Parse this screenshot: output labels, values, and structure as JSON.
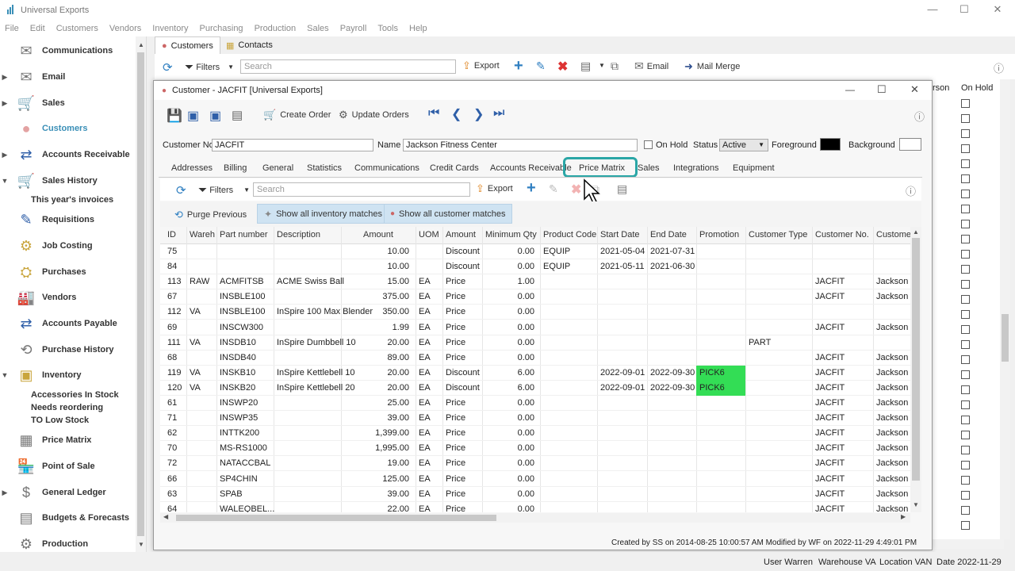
{
  "app": {
    "title": "Universal Exports"
  },
  "menu": [
    "File",
    "Edit",
    "Customers",
    "Vendors",
    "Inventory",
    "Purchasing",
    "Production",
    "Sales",
    "Payroll",
    "Tools",
    "Help"
  ],
  "sidebar": {
    "items": [
      {
        "label": "Communications",
        "icon": "communications-icon"
      },
      {
        "label": "Email",
        "icon": "email-icon"
      },
      {
        "label": "Sales",
        "icon": "cart-icon"
      },
      {
        "label": "Customers",
        "icon": "customers-icon"
      },
      {
        "label": "Accounts Receivable",
        "icon": "accounts-receivable-icon"
      },
      {
        "label": "Sales History",
        "icon": "sales-history-icon"
      },
      {
        "label": "Requisitions",
        "icon": "requisitions-icon"
      },
      {
        "label": "Job Costing",
        "icon": "job-costing-icon"
      },
      {
        "label": "Purchases",
        "icon": "purchases-icon"
      },
      {
        "label": "Vendors",
        "icon": "vendors-icon"
      },
      {
        "label": "Accounts Payable",
        "icon": "accounts-payable-icon"
      },
      {
        "label": "Purchase History",
        "icon": "purchase-history-icon"
      },
      {
        "label": "Inventory",
        "icon": "inventory-icon"
      },
      {
        "label": "Price Matrix",
        "icon": "price-matrix-icon"
      },
      {
        "label": "Point of Sale",
        "icon": "point-of-sale-icon"
      },
      {
        "label": "General Ledger",
        "icon": "general-ledger-icon"
      },
      {
        "label": "Budgets & Forecasts",
        "icon": "budgets-icon"
      },
      {
        "label": "Production",
        "icon": "production-icon"
      }
    ],
    "sub_sales_history": "This year's invoices",
    "sub_inventory": [
      "Accessories In Stock",
      "Needs reordering",
      "TO Low Stock"
    ]
  },
  "main": {
    "tabs": [
      "Customers",
      "Contacts"
    ],
    "filters": "Filters",
    "search_placeholder": "Search",
    "export": "Export",
    "email": "Email",
    "mail_merge": "Mail Merge",
    "bg_col_person": "rson",
    "bg_col_onhold": "On Hold"
  },
  "dialog": {
    "title": "Customer - JACFIT [Universal Exports]",
    "create_order": "Create Order",
    "update_orders": "Update Orders",
    "customer_no_label": "Customer No",
    "customer_no": "JACFIT",
    "name_label": "Name",
    "name": "Jackson Fitness Center",
    "on_hold_label": "On Hold",
    "status_label": "Status",
    "status": "Active",
    "foreground_label": "Foreground",
    "background_label": "Background",
    "tabs": [
      "Addresses",
      "Billing",
      "General",
      "Statistics",
      "Communications",
      "Credit Cards",
      "Accounts Receivable",
      "Price Matrix",
      "Sales",
      "Integrations",
      "Equipment"
    ],
    "active_tab": "Price Matrix",
    "filters": "Filters",
    "search_placeholder": "Search",
    "export": "Export",
    "purge_previous": "Purge Previous",
    "show_inventory": "Show all inventory matches",
    "show_customer": "Show all customer matches",
    "columns": [
      "ID",
      "Wareh",
      "Part number",
      "Description",
      "Amount",
      "UOM",
      "Amount",
      "Minimum Qty",
      "Product Code",
      "Start Date",
      "End Date",
      "Promotion",
      "Customer Type",
      "Customer No.",
      "Custome"
    ],
    "rows": [
      [
        "75",
        "",
        "",
        "",
        "10.00",
        "",
        "Discount",
        "0.00",
        "EQUIP",
        "2021-05-04",
        "2021-07-31",
        "",
        "",
        "",
        ""
      ],
      [
        "84",
        "",
        "",
        "",
        "10.00",
        "",
        "Discount",
        "0.00",
        "EQUIP",
        "2021-05-11",
        "2021-06-30",
        "",
        "",
        "",
        ""
      ],
      [
        "113",
        "RAW",
        "ACMFITSB",
        "ACME Swiss Ball",
        "15.00",
        "EA",
        "Price",
        "1.00",
        "",
        "",
        "",
        "",
        "",
        "JACFIT",
        "Jackson I"
      ],
      [
        "67",
        "",
        "INSBLE100",
        "",
        "375.00",
        "EA",
        "Price",
        "0.00",
        "",
        "",
        "",
        "",
        "",
        "JACFIT",
        "Jackson I"
      ],
      [
        "112",
        "VA",
        "INSBLE100",
        "InSpire 100 Max Blender",
        "350.00",
        "EA",
        "Price",
        "0.00",
        "",
        "",
        "",
        "",
        "",
        "",
        ""
      ],
      [
        "69",
        "",
        "INSCW300",
        "",
        "1.99",
        "EA",
        "Price",
        "0.00",
        "",
        "",
        "",
        "",
        "",
        "JACFIT",
        "Jackson I"
      ],
      [
        "111",
        "VA",
        "INSDB10",
        "InSpire Dumbbell 10",
        "20.00",
        "EA",
        "Price",
        "0.00",
        "",
        "",
        "",
        "",
        "PART",
        "",
        ""
      ],
      [
        "68",
        "",
        "INSDB40",
        "",
        "89.00",
        "EA",
        "Price",
        "0.00",
        "",
        "",
        "",
        "",
        "",
        "JACFIT",
        "Jackson I"
      ],
      [
        "119",
        "VA",
        "INSKB10",
        "InSpire Kettlebell 10",
        "20.00",
        "EA",
        "Discount",
        "6.00",
        "",
        "2022-09-01",
        "2022-09-30",
        "PICK6",
        "",
        "JACFIT",
        "Jackson I"
      ],
      [
        "120",
        "VA",
        "INSKB20",
        "InSpire Kettlebell 20",
        "20.00",
        "EA",
        "Discount",
        "6.00",
        "",
        "2022-09-01",
        "2022-09-30",
        "PICK6",
        "",
        "JACFIT",
        "Jackson I"
      ],
      [
        "61",
        "",
        "INSWP20",
        "",
        "25.00",
        "EA",
        "Price",
        "0.00",
        "",
        "",
        "",
        "",
        "",
        "JACFIT",
        "Jackson I"
      ],
      [
        "71",
        "",
        "INSWP35",
        "",
        "39.00",
        "EA",
        "Price",
        "0.00",
        "",
        "",
        "",
        "",
        "",
        "JACFIT",
        "Jackson I"
      ],
      [
        "62",
        "",
        "INTTK200",
        "",
        "1,399.00",
        "EA",
        "Price",
        "0.00",
        "",
        "",
        "",
        "",
        "",
        "JACFIT",
        "Jackson I"
      ],
      [
        "70",
        "",
        "MS-RS1000",
        "",
        "1,995.00",
        "EA",
        "Price",
        "0.00",
        "",
        "",
        "",
        "",
        "",
        "JACFIT",
        "Jackson I"
      ],
      [
        "72",
        "",
        "NATACCBAL",
        "",
        "19.00",
        "EA",
        "Price",
        "0.00",
        "",
        "",
        "",
        "",
        "",
        "JACFIT",
        "Jackson I"
      ],
      [
        "66",
        "",
        "SP4CHIN",
        "",
        "125.00",
        "EA",
        "Price",
        "0.00",
        "",
        "",
        "",
        "",
        "",
        "JACFIT",
        "Jackson I"
      ],
      [
        "63",
        "",
        "SPAB",
        "",
        "39.00",
        "EA",
        "Price",
        "0.00",
        "",
        "",
        "",
        "",
        "",
        "JACFIT",
        "Jackson I"
      ],
      [
        "64",
        "",
        "WALEQBEL...",
        "",
        "22.00",
        "EA",
        "Price",
        "0.00",
        "",
        "",
        "",
        "",
        "",
        "JACFIT",
        "Jackson I"
      ]
    ],
    "footer": "Created by SS on 2014-08-25 10:00:57 AM  Modified by WF on 2022-11-29 4:49:01 PM"
  },
  "status": {
    "user": "User Warren",
    "warehouse": "Warehouse VA",
    "location": "Location VAN",
    "date": "Date 2022-11-29"
  },
  "colors": {
    "promo": "#33dd55",
    "accent": "#3a8fb7",
    "highlight": "#2aa6a6"
  }
}
